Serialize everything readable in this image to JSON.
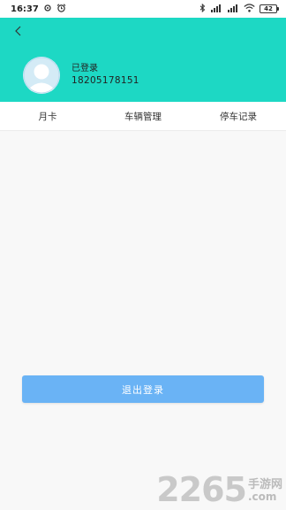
{
  "status_bar": {
    "time": "16:37",
    "battery": "42",
    "signal_1": "HD",
    "signal_2": "HD"
  },
  "header": {
    "user_status": "已登录",
    "phone": "18205178151",
    "bg_color": "#1dd8c4"
  },
  "tabs": [
    {
      "label": "月卡"
    },
    {
      "label": "车辆管理"
    },
    {
      "label": "停车记录"
    }
  ],
  "logout": {
    "label": "退出登录",
    "color": "#6ab3f5"
  },
  "watermark": {
    "number": "2265",
    "site_cn": "手游网",
    "site_en": ".com"
  }
}
